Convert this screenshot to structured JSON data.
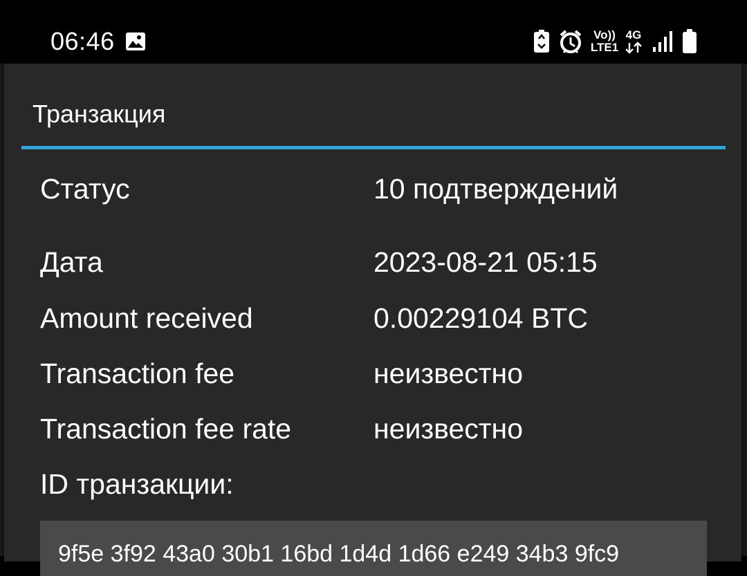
{
  "status_bar": {
    "time": "06:46",
    "volte_line1": "Vo))",
    "volte_line2": "LTE1",
    "network_type": "4G",
    "icons": [
      "gallery-icon",
      "recycle-battery-icon",
      "alarm-icon",
      "volte-icon",
      "data-arrows-icon",
      "signal-icon",
      "battery-icon"
    ]
  },
  "dialog": {
    "title": "Транзакция",
    "accent_color": "#33a3dc",
    "rows": [
      {
        "label": "Статус",
        "value": "10 подтверждений"
      },
      {
        "label": "Дата",
        "value": "2023-08-21 05:15"
      },
      {
        "label": "Amount received",
        "value": "0.00229104 BTC"
      },
      {
        "label": "Transaction fee",
        "value": "неизвестно"
      },
      {
        "label": "Transaction fee rate",
        "value": "неизвестно"
      }
    ],
    "txid_label": "ID транзакции:",
    "txid_value": "9f5e 3f92 43a0 30b1 16bd 1d4d 1d66 e249 34b3 9fc9"
  }
}
